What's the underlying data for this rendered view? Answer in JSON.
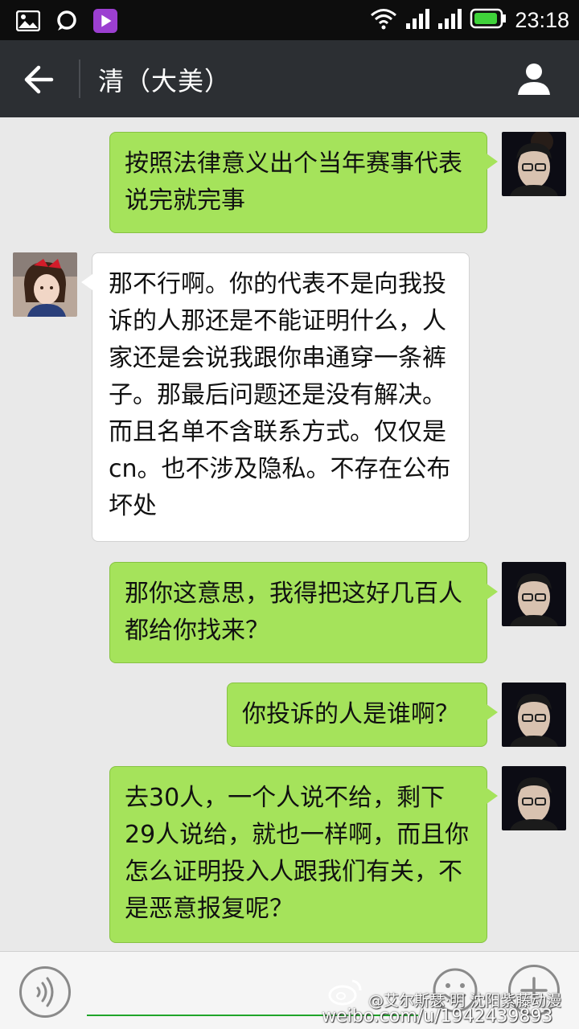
{
  "status_bar": {
    "time": "23:18",
    "icons": [
      "gallery-icon",
      "chat-notification-icon",
      "video-app-icon",
      "wifi-icon",
      "signal-icon",
      "signal-icon",
      "battery-icon"
    ]
  },
  "header": {
    "title": "清（大美）",
    "back_icon": "back-arrow-icon",
    "profile_icon": "profile-icon"
  },
  "messages": [
    {
      "side": "out",
      "text": "按照法律意义出个当年赛事代表说完就完事"
    },
    {
      "side": "in",
      "text": "那不行啊。你的代表不是向我投诉的人那还是不能证明什么，人家还是会说我跟你串通穿一条裤子。那最后问题还是没有解决。而且名单不含联系方式。仅仅是cn。也不涉及隐私。不存在公布坏处"
    },
    {
      "side": "out",
      "text": "那你这意思，我得把这好几百人都给你找来？"
    },
    {
      "side": "out",
      "text": "你投诉的人是谁啊？"
    },
    {
      "side": "out",
      "text": "去30人，一个人说不给，剩下29人说给，就也一样啊，而且你怎么证明投入人跟我们有关，不是恶意报复呢？"
    }
  ],
  "input_bar": {
    "voice_icon": "voice-icon",
    "emoji_icon": "emoji-icon",
    "plus_icon": "plus-icon"
  },
  "watermark": {
    "line1": "@艾尔斯瑟·明 沈阳紫藤动漫",
    "line2": "weibo.com/u/1942439893"
  },
  "colors": {
    "outgoing_bubble": "#a5e35b",
    "incoming_bubble": "#ffffff",
    "title_bar": "#2c2f33",
    "background": "#e9e9e9"
  }
}
